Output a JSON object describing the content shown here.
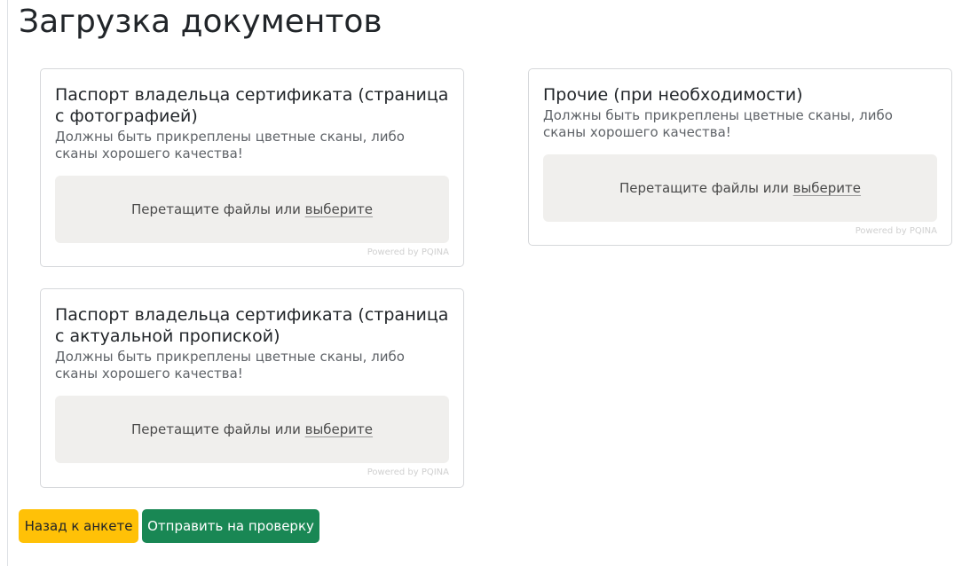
{
  "page": {
    "title": "Загрузка документов"
  },
  "cards": [
    {
      "title": "Паспорт владельца сертификата (страница с фотографией)",
      "note": "Должны быть прикреплены цветные сканы, либо сканы хорошего качества!",
      "dropzone": {
        "prompt": "Перетащите файлы или",
        "browse": "выберите"
      },
      "powered_by": "Powered by PQINA"
    },
    {
      "title": "Прочие (при необходимости)",
      "note": "Должны быть прикреплены цветные сканы, либо сканы хорошего качества!",
      "dropzone": {
        "prompt": "Перетащите файлы или",
        "browse": "выберите"
      },
      "powered_by": "Powered by PQINA"
    },
    {
      "title": "Паспорт владельца сертификата (страница с актуальной пропиской)",
      "note": "Должны быть прикреплены цветные сканы, либо сканы хорошего качества!",
      "dropzone": {
        "prompt": "Перетащите файлы или",
        "browse": "выберите"
      },
      "powered_by": "Powered by PQINA"
    }
  ],
  "actions": {
    "back_label": "Назад к анкете",
    "submit_label": "Отправить на проверку"
  },
  "colors": {
    "back_button": "#ffc107",
    "submit_button": "#198754",
    "dropzone_bg": "#f0efed"
  }
}
